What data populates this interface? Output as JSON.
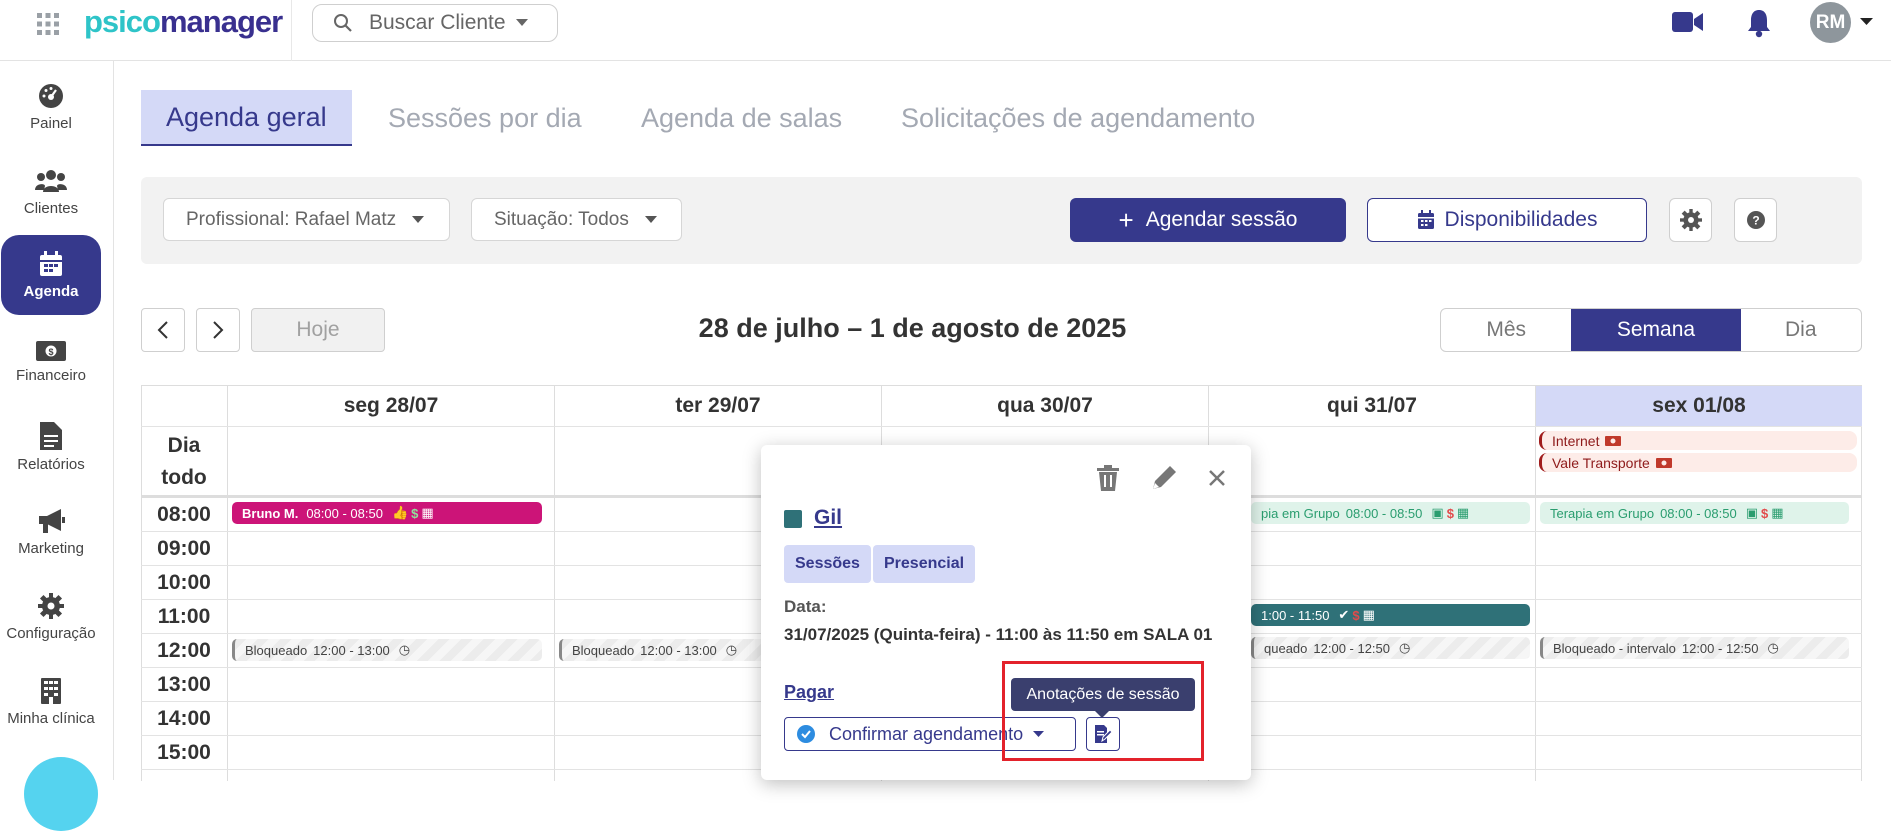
{
  "app": {
    "logo_part1": "psico",
    "logo_part2": "manager",
    "search_placeholder": "Buscar Cliente",
    "avatar_initials": "RM"
  },
  "sidebar": {
    "items": [
      {
        "label": "Painel",
        "icon": "dashboard-icon"
      },
      {
        "label": "Clientes",
        "icon": "users-icon"
      },
      {
        "label": "Agenda",
        "icon": "calendar-icon",
        "active": true
      },
      {
        "label": "Financeiro",
        "icon": "money-icon"
      },
      {
        "label": "Relatórios",
        "icon": "file-icon"
      },
      {
        "label": "Marketing",
        "icon": "megaphone-icon"
      },
      {
        "label": "Configuração",
        "icon": "gear-icon"
      },
      {
        "label": "Minha clínica",
        "icon": "building-icon"
      }
    ]
  },
  "tabs": [
    {
      "label": "Agenda geral",
      "active": true
    },
    {
      "label": "Sessões por dia"
    },
    {
      "label": "Agenda de salas"
    },
    {
      "label": "Solicitações de agendamento"
    }
  ],
  "filters": {
    "professional": "Profissional: Rafael Matz",
    "status": "Situação: Todos",
    "schedule_button": "Agendar sessão",
    "availability_button": "Disponibilidades"
  },
  "calendar": {
    "title": "28 de julho – 1 de agosto de 2025",
    "today_button": "Hoje",
    "views": [
      "Mês",
      "Semana",
      "Dia"
    ],
    "active_view": "Semana",
    "allday_label_1": "Dia",
    "allday_label_2": "todo",
    "days": [
      "seg 28/07",
      "ter 29/07",
      "qua 30/07",
      "qui 31/07",
      "sex 01/08"
    ],
    "today_index": 4,
    "hours": [
      "08:00",
      "09:00",
      "10:00",
      "11:00",
      "12:00",
      "13:00",
      "14:00",
      "15:00"
    ],
    "allday_events": [
      {
        "label": "Internet",
        "day": 4
      },
      {
        "label": "Vale Transporte",
        "day": 4
      }
    ],
    "events": {
      "mon_bruno_name": "Bruno M.",
      "mon_bruno_time": "08:00 - 08:50",
      "mon_block": "Bloqueado",
      "mon_block_time": "12:00 - 13:00",
      "tue_block": "Bloqueado",
      "tue_block_time": "12:00 - 13:00",
      "thu_group": "pia em Grupo",
      "thu_group_time": "08:00 - 08:50",
      "thu_gil_time": "1:00 - 11:50",
      "thu_block": "queado",
      "thu_block_time": "12:00 - 12:50",
      "fri_group": "Terapia em Grupo",
      "fri_group_time": "08:00 - 08:50",
      "fri_block": "Bloqueado - intervalo",
      "fri_block_time": "12:00 - 12:50"
    }
  },
  "popover": {
    "client_name": "Gil",
    "tags": [
      "Sessões",
      "Presencial"
    ],
    "date_label": "Data:",
    "date_text": "31/07/2025 (Quinta-feira) - 11:00 às 11:50 em SALA 01",
    "pay_link": "Pagar",
    "confirm_button": "Confirmar agendamento",
    "notes_tooltip": "Anotações de sessão"
  },
  "colors": {
    "primary": "#36398c",
    "accent_light": "#d4d9f7",
    "teal": "#2f7178",
    "pink": "#cc1478",
    "highlight": "#e3222b"
  }
}
